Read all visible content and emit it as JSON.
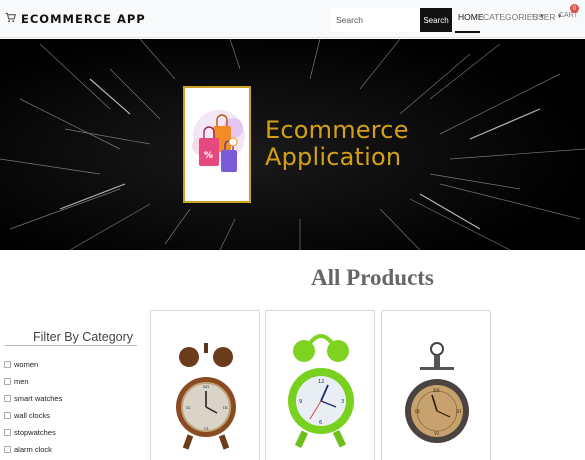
{
  "navbar": {
    "brand": "ECOMMERCE APP",
    "brand_icon": "cart-icon",
    "search_placeholder": "Search",
    "search_button": "Search",
    "links": {
      "home": "HOME",
      "categories": "CATEGORIES",
      "user": "USER",
      "cart": "CART"
    },
    "cart_count": "0"
  },
  "banner": {
    "title_line1": "Ecommerce",
    "title_line2": "Application",
    "accent_color": "#d4a017"
  },
  "main": {
    "heading": "All Products"
  },
  "filter": {
    "heading": "Filter By Category",
    "categories": [
      "women",
      "men",
      "smart watches",
      "wall clocks",
      "stopwatches",
      "alarm clock"
    ]
  },
  "products": [
    {
      "image": "brown-alarm-clock"
    },
    {
      "image": "green-alarm-clock"
    },
    {
      "image": "antique-pocket-clock"
    }
  ]
}
